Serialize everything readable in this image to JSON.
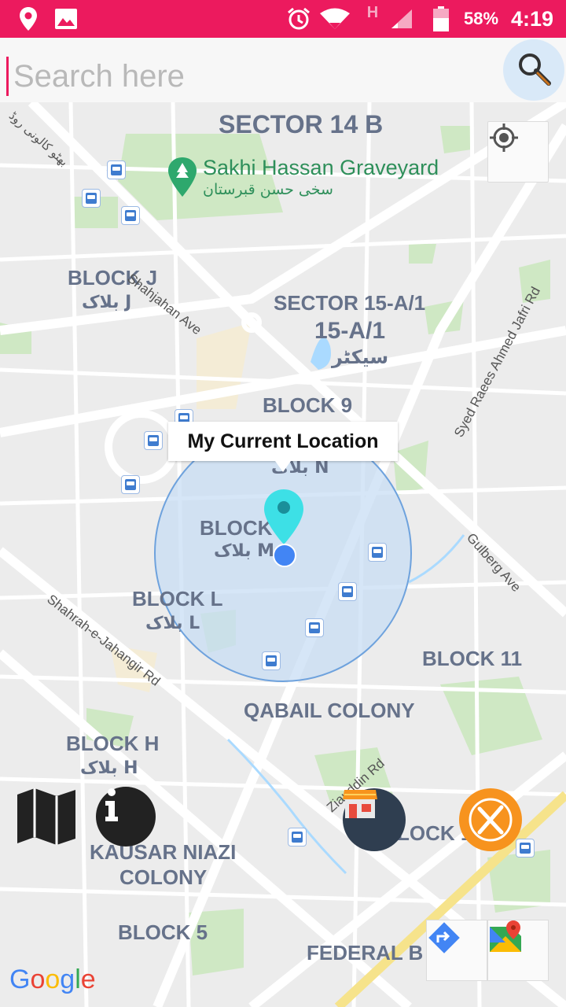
{
  "status_bar": {
    "battery_percent": "58%",
    "time": "4:19",
    "network_letter": "H",
    "icons": [
      "location-pin-icon",
      "gallery-icon",
      "alarm-icon",
      "wifi-icon",
      "network-signal-icon",
      "battery-icon"
    ],
    "bg_color": "#ec1a5e"
  },
  "search": {
    "placeholder": "Search here",
    "value": "",
    "button_icon": "search-icon"
  },
  "map": {
    "labels": {
      "sector_14b": "SECTOR 14 B",
      "graveyard": "Sakhi Hassan Graveyard",
      "graveyard_urdu": "سخی حسن قبرستان",
      "block_j": "BLOCK J",
      "block_j_urdu": "بلاک J",
      "sector_15a1": "SECTOR 15-A/1",
      "sector_15a1_sub": "15-A/1",
      "sector_urdu": "سیکٹر",
      "block_9": "BLOCK 9",
      "block_m": "BLOCK",
      "block_m_urdu": "بلاک M",
      "block_l": "BLOCK L",
      "block_l_urdu": "بلاک L",
      "block_11": "BLOCK 11",
      "qabail_colony": "QABAIL COLONY",
      "block_h": "BLOCK H",
      "block_h_urdu": "بلاک H",
      "kausar_niazi": "KAUSAR NIAZI",
      "colony": "COLONY",
      "block_5": "BLOCK 5",
      "federal_b_area": "FEDERAL B AREA",
      "block_partial": "LOCK 1",
      "block_n_urdu": "بلاک N"
    },
    "roads": {
      "shahjahan": "Shahjahan Ave",
      "syed_raees": "Syed Raees Ahmed Jafri Rd",
      "gulberg": "Gulberg Ave",
      "jahangir": "Shahrah-e-Jahangir Rd",
      "ziauddin": "Ziauddin Rd",
      "urdu_road": "بھٹو کالونی روڈ"
    },
    "callout": "My Current Location",
    "accuracy_circle_color": "#5b9be6",
    "marker_color": "#3de0e6",
    "location_dot_color": "#4285f4",
    "my_location_icon": "my-location-icon",
    "attribution": [
      "G",
      "o",
      "o",
      "g",
      "l",
      "e"
    ],
    "attribution_colors": [
      "#4285f4",
      "#ea4335",
      "#fbbc05",
      "#4285f4",
      "#34a853",
      "#ea4335"
    ]
  },
  "fabs": {
    "map_icon": "folded-map-icon",
    "info_icon": "info-icon",
    "store_icon": "store-icon",
    "restaurant_icon": "restaurant-icon",
    "restaurant_color": "#f7931e",
    "store_bg": "#2f3e50"
  },
  "map_controls": {
    "directions_icon": "directions-icon",
    "google_maps_icon": "google-maps-icon"
  }
}
